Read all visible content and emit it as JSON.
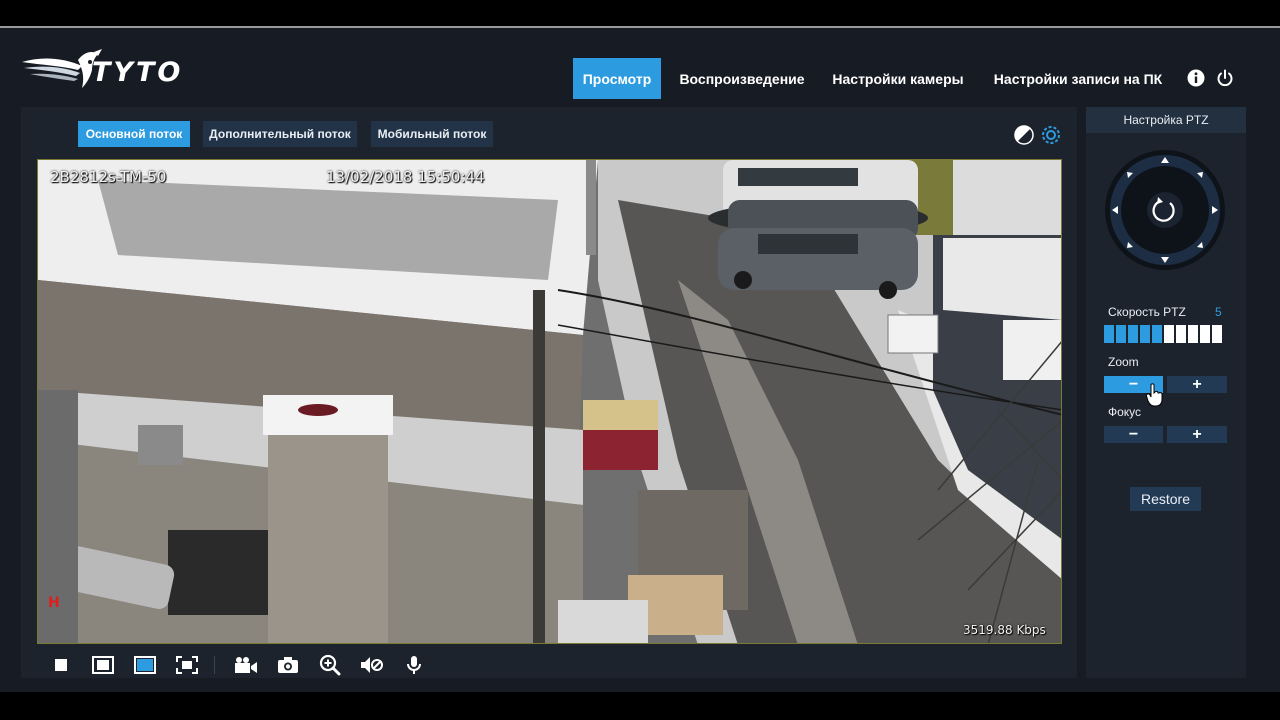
{
  "brand": {
    "name": "TYTO"
  },
  "nav": {
    "items": [
      {
        "label": "Просмотр",
        "active": true
      },
      {
        "label": "Воспроизведение",
        "active": false
      },
      {
        "label": "Настройки камеры",
        "active": false
      },
      {
        "label": "Настройки записи на ПК",
        "active": false
      }
    ],
    "icons": [
      "info-icon",
      "power-icon"
    ]
  },
  "streams": {
    "items": [
      {
        "label": "Основной поток",
        "active": true
      },
      {
        "label": "Дополнительный поток",
        "active": false
      },
      {
        "label": "Мобильный поток",
        "active": false
      }
    ]
  },
  "video": {
    "camera_name": "2B2812s-TM-50",
    "timestamp": "13/02/2018 15:50:44",
    "bitrate": "3519.88 Kbps",
    "rec_marker": "H"
  },
  "toolbar": {
    "icons": [
      "single-view-icon",
      "window-view-icon",
      "fit-view-icon",
      "fullscreen-icon",
      "record-icon",
      "snapshot-icon",
      "digital-zoom-icon",
      "mute-icon",
      "microphone-icon"
    ],
    "active": "fit-view-icon"
  },
  "ptz": {
    "title": "Настройка PTZ",
    "speed_label": "Скорость PTZ",
    "speed_value": "5",
    "speed_level": 5,
    "speed_max": 10,
    "zoom_label": "Zoom",
    "focus_label": "Фокус",
    "minus": "−",
    "plus": "+",
    "restore_label": "Restore"
  },
  "colors": {
    "accent": "#2d9be0",
    "header_bg": "#171c24",
    "panel_bg": "#1d232c",
    "button_bg": "#233a55"
  }
}
